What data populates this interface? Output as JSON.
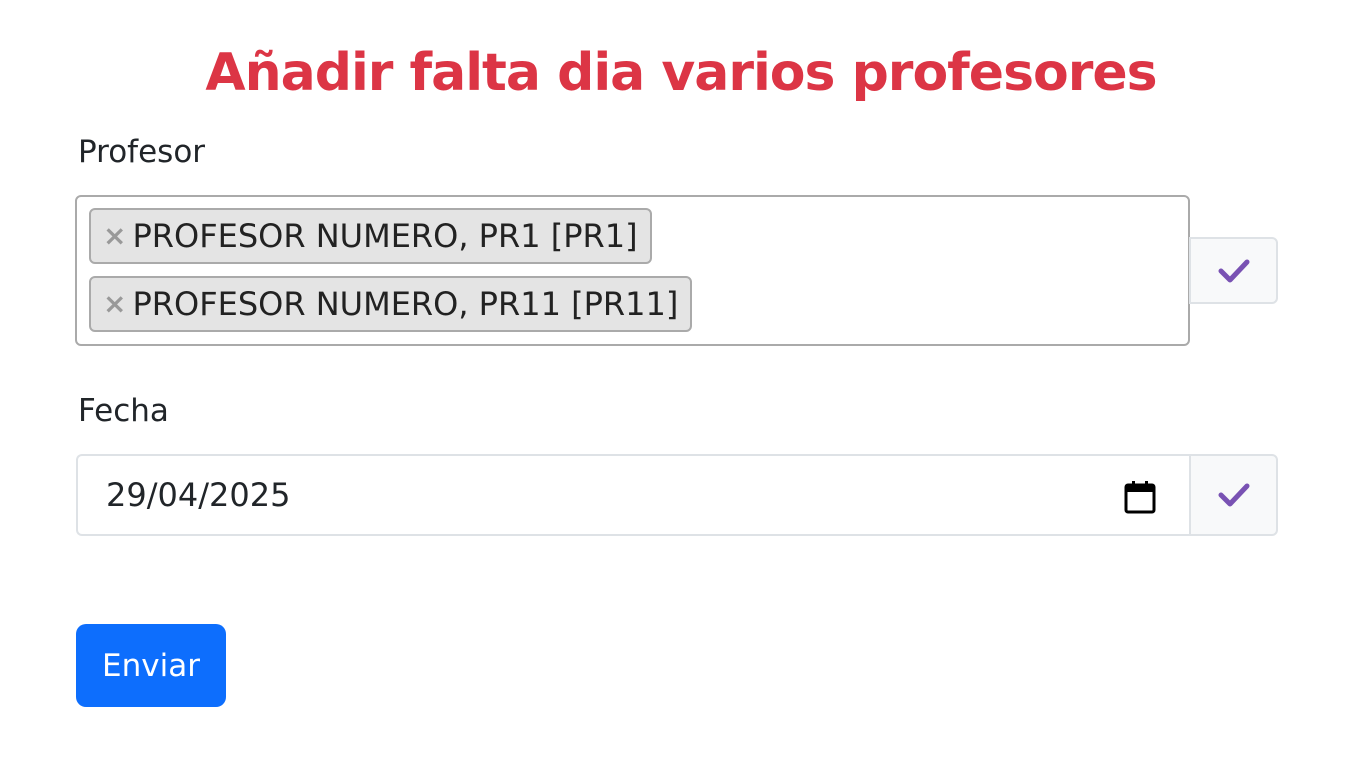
{
  "page": {
    "title": "Añadir falta dia varios profesores"
  },
  "form": {
    "profesor": {
      "label": "Profesor",
      "selected": [
        {
          "remove_symbol": "×",
          "label": "PROFESOR NUMERO, PR1 [PR1]"
        },
        {
          "remove_symbol": "×",
          "label": "PROFESOR NUMERO, PR11 [PR11]"
        }
      ],
      "validation_icon": "check-icon"
    },
    "fecha": {
      "label": "Fecha",
      "value": "29/04/2025",
      "picker_icon": "calendar-icon",
      "validation_icon": "check-icon"
    },
    "submit_label": "Enviar"
  },
  "colors": {
    "title": "#dc3545",
    "primary": "#0d6efd",
    "check": "#7952b3",
    "tag_bg": "#e4e4e4"
  }
}
